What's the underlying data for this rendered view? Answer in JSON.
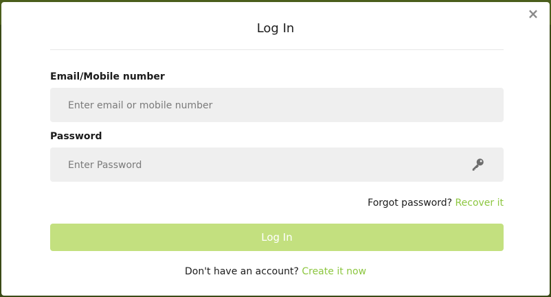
{
  "modal": {
    "title": "Log In",
    "close_glyph": "×"
  },
  "email": {
    "label": "Email/Mobile number",
    "placeholder": "Enter email or mobile number",
    "value": ""
  },
  "password": {
    "label": "Password",
    "placeholder": "Enter Password",
    "value": "",
    "icon": "key-icon"
  },
  "forgot": {
    "prompt": "Forgot password?",
    "link": "Recover it"
  },
  "login_button": {
    "label": "Log In"
  },
  "signup": {
    "prompt": "Don't have an account?",
    "link": "Create it now"
  },
  "colors": {
    "accent": "#8cc63f",
    "button_disabled": "#c3e07f",
    "field_bg": "#efefef"
  }
}
